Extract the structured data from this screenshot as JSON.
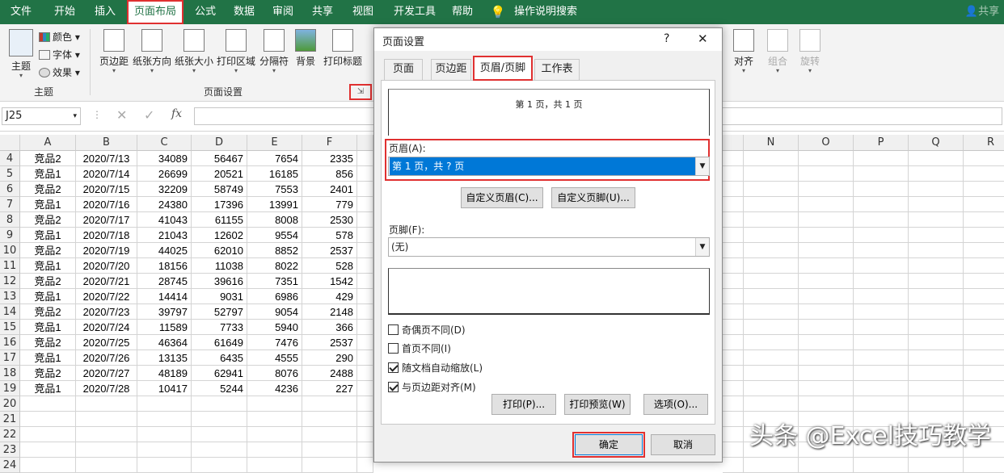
{
  "ribbon_tabs": [
    "文件",
    "开始",
    "插入",
    "页面布局",
    "公式",
    "数据",
    "审阅",
    "共享",
    "视图",
    "开发工具",
    "帮助",
    "操作说明搜索"
  ],
  "share_label": "共享",
  "ribbon": {
    "theme_btn": "主题",
    "colors": "颜色",
    "fonts": "字体",
    "effects": "效果",
    "theme_group": "主题",
    "margins": "页边距",
    "orientation": "纸张方向",
    "size": "纸张大小",
    "print_area": "打印区域",
    "breaks": "分隔符",
    "background": "背景",
    "print_titles": "打印标题",
    "page_setup_group": "页面设置",
    "align": "对齐",
    "group": "组合",
    "rotate": "旋转"
  },
  "formula_bar": {
    "name_box": "J25",
    "fx": "fx",
    "content": ""
  },
  "columns": [
    "A",
    "B",
    "C",
    "D",
    "E",
    "F",
    "N",
    "O",
    "P",
    "Q",
    "R"
  ],
  "rows": [
    {
      "n": "4",
      "a": "竞品2",
      "b": "2020/7/13",
      "c": "34089",
      "d": "56467",
      "e": "7654",
      "f": "2335"
    },
    {
      "n": "5",
      "a": "竞品1",
      "b": "2020/7/14",
      "c": "26699",
      "d": "20521",
      "e": "16185",
      "f": "856"
    },
    {
      "n": "6",
      "a": "竞品2",
      "b": "2020/7/15",
      "c": "32209",
      "d": "58749",
      "e": "7553",
      "f": "2401"
    },
    {
      "n": "7",
      "a": "竞品1",
      "b": "2020/7/16",
      "c": "24380",
      "d": "17396",
      "e": "13991",
      "f": "779"
    },
    {
      "n": "8",
      "a": "竞品2",
      "b": "2020/7/17",
      "c": "41043",
      "d": "61155",
      "e": "8008",
      "f": "2530"
    },
    {
      "n": "9",
      "a": "竞品1",
      "b": "2020/7/18",
      "c": "21043",
      "d": "12602",
      "e": "9554",
      "f": "578"
    },
    {
      "n": "10",
      "a": "竞品2",
      "b": "2020/7/19",
      "c": "44025",
      "d": "62010",
      "e": "8852",
      "f": "2537"
    },
    {
      "n": "11",
      "a": "竞品1",
      "b": "2020/7/20",
      "c": "18156",
      "d": "11038",
      "e": "8022",
      "f": "528"
    },
    {
      "n": "12",
      "a": "竞品2",
      "b": "2020/7/21",
      "c": "28745",
      "d": "39616",
      "e": "7351",
      "f": "1542"
    },
    {
      "n": "13",
      "a": "竞品1",
      "b": "2020/7/22",
      "c": "14414",
      "d": "9031",
      "e": "6986",
      "f": "429"
    },
    {
      "n": "14",
      "a": "竞品2",
      "b": "2020/7/23",
      "c": "39797",
      "d": "52797",
      "e": "9054",
      "f": "2148"
    },
    {
      "n": "15",
      "a": "竞品1",
      "b": "2020/7/24",
      "c": "11589",
      "d": "7733",
      "e": "5940",
      "f": "366"
    },
    {
      "n": "16",
      "a": "竞品2",
      "b": "2020/7/25",
      "c": "46364",
      "d": "61649",
      "e": "7476",
      "f": "2537"
    },
    {
      "n": "17",
      "a": "竞品1",
      "b": "2020/7/26",
      "c": "13135",
      "d": "6435",
      "e": "4555",
      "f": "290"
    },
    {
      "n": "18",
      "a": "竞品2",
      "b": "2020/7/27",
      "c": "48189",
      "d": "62941",
      "e": "8076",
      "f": "2488"
    },
    {
      "n": "19",
      "a": "竞品1",
      "b": "2020/7/28",
      "c": "10417",
      "d": "5244",
      "e": "4236",
      "f": "227"
    },
    {
      "n": "20"
    },
    {
      "n": "21"
    },
    {
      "n": "22"
    },
    {
      "n": "23"
    },
    {
      "n": "24"
    }
  ],
  "dialog": {
    "title": "页面设置",
    "help": "?",
    "close": "✕",
    "tabs": [
      "页面",
      "页边距",
      "页眉/页脚",
      "工作表"
    ],
    "header_preview": "第 1 页，共 1 页",
    "header_label": "页眉(A):",
    "header_value": "第 1 页，共 ? 页",
    "custom_header": "自定义页眉(C)...",
    "custom_footer": "自定义页脚(U)...",
    "footer_label": "页脚(F):",
    "footer_value": "(无)",
    "checkboxes": [
      {
        "label": "奇偶页不同(D)",
        "checked": false
      },
      {
        "label": "首页不同(I)",
        "checked": false
      },
      {
        "label": "随文档自动缩放(L)",
        "checked": true
      },
      {
        "label": "与页边距对齐(M)",
        "checked": true
      }
    ],
    "print": "打印(P)...",
    "print_preview": "打印预览(W)",
    "options": "选项(O)...",
    "ok": "确定",
    "cancel": "取消"
  },
  "watermark": "头条 @Excel技巧教学",
  "colors": {
    "ribbon_green": "#217346",
    "highlight_red": "#e03030",
    "selection_blue": "#0078d7"
  }
}
